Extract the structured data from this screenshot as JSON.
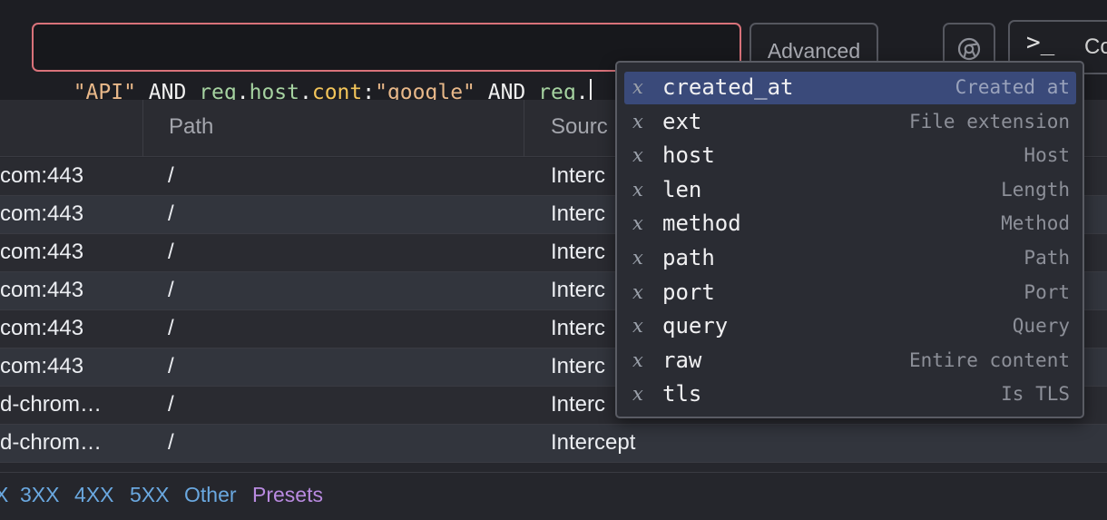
{
  "query": {
    "tokens": [
      {
        "text": "\"API\"",
        "kind": "str"
      },
      {
        "text": " AND ",
        "kind": "kw"
      },
      {
        "text": "req",
        "kind": "field"
      },
      {
        "text": ".",
        "kind": "punct"
      },
      {
        "text": "host",
        "kind": "field"
      },
      {
        "text": ".",
        "kind": "punct"
      },
      {
        "text": "cont",
        "kind": "op"
      },
      {
        "text": ":",
        "kind": "punct"
      },
      {
        "text": "\"google\"",
        "kind": "str"
      },
      {
        "text": " AND ",
        "kind": "kw"
      },
      {
        "text": "req",
        "kind": "field"
      },
      {
        "text": ".",
        "kind": "punct"
      }
    ]
  },
  "toolbar": {
    "advanced_label": "Advanced",
    "console_icon": ">_",
    "console_label": "Co"
  },
  "table": {
    "headers": [
      "Path",
      "Sourc"
    ],
    "rows": [
      {
        "host": "com:443",
        "path": "/",
        "source": "Interc"
      },
      {
        "host": "com:443",
        "path": "/",
        "source": "Interc"
      },
      {
        "host": "com:443",
        "path": "/",
        "source": "Interc"
      },
      {
        "host": "com:443",
        "path": "/",
        "source": "Interc"
      },
      {
        "host": "com:443",
        "path": "/",
        "source": "Interc"
      },
      {
        "host": "com:443",
        "path": "/",
        "source": "Interc"
      },
      {
        "host": "d-chrom…",
        "path": "/",
        "source": "Interc"
      },
      {
        "host": "d-chrom…",
        "path": "/",
        "source": "Intercept"
      }
    ]
  },
  "filters": {
    "items": [
      "X",
      "3XX",
      "4XX",
      "5XX",
      "Other"
    ],
    "presets_label": "Presets"
  },
  "autocomplete": {
    "icon_glyph": "x",
    "selected_index": 0,
    "items": [
      {
        "name": "created_at",
        "desc": "Created at"
      },
      {
        "name": "ext",
        "desc": "File extension"
      },
      {
        "name": "host",
        "desc": "Host"
      },
      {
        "name": "len",
        "desc": "Length"
      },
      {
        "name": "method",
        "desc": "Method"
      },
      {
        "name": "path",
        "desc": "Path"
      },
      {
        "name": "port",
        "desc": "Port"
      },
      {
        "name": "query",
        "desc": "Query"
      },
      {
        "name": "raw",
        "desc": "Entire content"
      },
      {
        "name": "tls",
        "desc": "Is TLS"
      }
    ]
  },
  "colors": {
    "accent_border": "#d9727a",
    "selected_bg": "#3a4a7a",
    "filter_link": "#6aa8e0",
    "preset_link": "#b98ae0"
  }
}
